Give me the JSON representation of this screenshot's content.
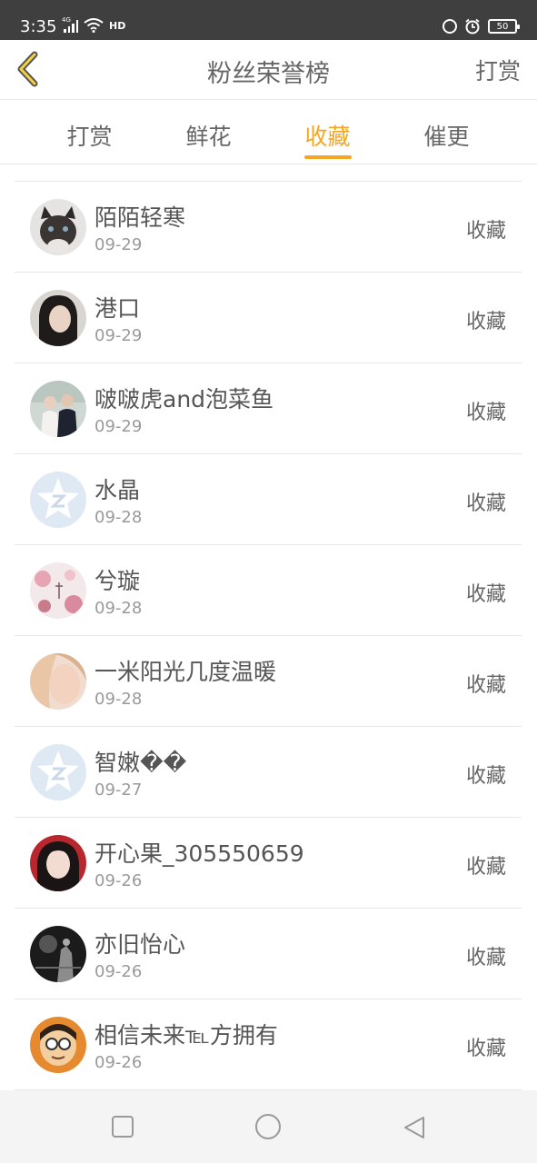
{
  "status_bar": {
    "time": "3:35",
    "network": "4G",
    "hd": "HD",
    "battery": "50"
  },
  "header": {
    "title": "粉丝荣誉榜",
    "right_link": "打赏"
  },
  "tabs": [
    {
      "label": "打赏"
    },
    {
      "label": "鲜花"
    },
    {
      "label": "收藏",
      "active": true
    },
    {
      "label": "催更"
    }
  ],
  "list": [
    {
      "name": "陌陌轻寒",
      "date": "09-29",
      "action": "收藏",
      "avatar": "cat-photo"
    },
    {
      "name": "港口",
      "date": "09-29",
      "action": "收藏",
      "avatar": "portrait-photo"
    },
    {
      "name": "啵啵虎and泡菜鱼",
      "date": "09-29",
      "action": "收藏",
      "avatar": "couple-photo"
    },
    {
      "name": "水晶",
      "date": "09-28",
      "action": "收藏",
      "avatar": "default-qq-avatar"
    },
    {
      "name": "兮璇",
      "date": "09-28",
      "action": "收藏",
      "avatar": "flower-photo"
    },
    {
      "name": "一米阳光几度温暖",
      "date": "09-28",
      "action": "收藏",
      "avatar": "girl-photo"
    },
    {
      "name": "智嫩��",
      "date": "09-27",
      "action": "收藏",
      "avatar": "default-qq-avatar"
    },
    {
      "name": "开心果_305550659",
      "date": "09-26",
      "action": "收藏",
      "avatar": "girl-red-photo"
    },
    {
      "name": "亦旧怡心",
      "date": "09-26",
      "action": "收藏",
      "avatar": "bw-photo"
    },
    {
      "name": "相信未来℡方拥有",
      "date": "09-26",
      "action": "收藏",
      "avatar": "cartoon-photo"
    }
  ],
  "colors": {
    "accent": "#f5a623",
    "status_bar": "#3f3f3f"
  }
}
